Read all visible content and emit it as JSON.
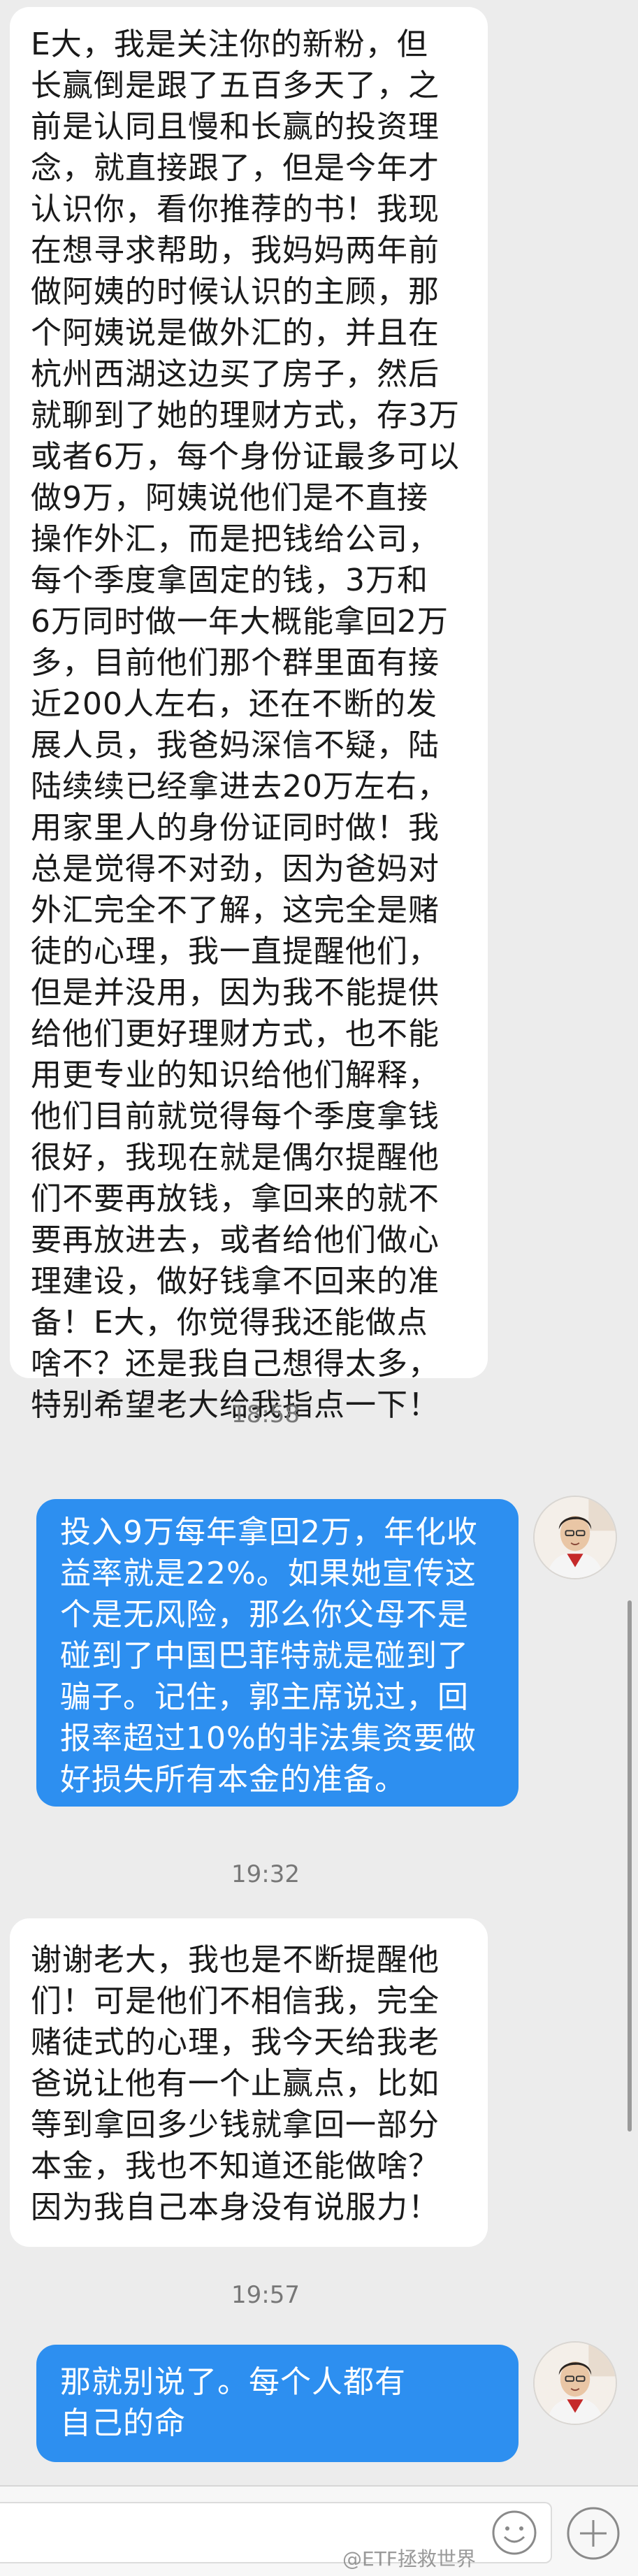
{
  "messages": [
    {
      "side": "left",
      "text": "E大，我是关注你的新粉，但\n长赢倒是跟了五百多天了，之\n前是认同且慢和长赢的投资理\n念，就直接跟了，但是今年才\n认识你，看你推荐的书！我现\n在想寻求帮助，我妈妈两年前\n做阿姨的时候认识的主顾，那\n个阿姨说是做外汇的，并且在\n杭州西湖这边买了房子，然后\n就聊到了她的理财方式，存3万\n或者6万，每个身份证最多可以\n做9万，阿姨说他们是不直接\n操作外汇，而是把钱给公司，\n每个季度拿固定的钱，3万和\n6万同时做一年大概能拿回2万\n多，目前他们那个群里面有接\n近200人左右，还在不断的发\n展人员，我爸妈深信不疑，陆\n陆续续已经拿进去20万左右，\n用家里人的身份证同时做！我\n总是觉得不对劲，因为爸妈对\n外汇完全不了解，这完全是赌\n徒的心理，我一直提醒他们，\n但是并没用，因为我不能提供\n给他们更好理财方式，也不能\n用更专业的知识给他们解释，\n他们目前就觉得每个季度拿钱\n很好，我现在就是偶尔提醒他\n们不要再放钱，拿回来的就不\n要再放进去，或者给他们做心\n理建设，做好钱拿不回来的准\n备！E大，你觉得我还能做点\n啥不？还是我自己想得太多，\n特别希望老大给我指点一下！"
    },
    {
      "side": "right",
      "text": "投入9万每年拿回2万，年化收\n益率就是22%。如果她宣传这\n个是无风险，那么你父母不是\n碰到了中国巴菲特就是碰到了\n骗子。记住，郭主席说过，回\n报率超过10%的非法集资要做\n好损失所有本金的准备。"
    },
    {
      "side": "left",
      "text": "谢谢老大，我也是不断提醒他\n们！可是他们不相信我，完全\n赌徒式的心理，我今天给我老\n爸说让他有一个止赢点，比如\n等到拿回多少钱就拿回一部分\n本金，我也不知道还能做啥？\n因为我自己本身没有说服力！"
    },
    {
      "side": "right",
      "text": "那就别说了。每个人都有\n自己的命"
    }
  ],
  "timestamps": [
    "18:58",
    "19:32",
    "19:57"
  ],
  "watermark": "@ETF拯救世界",
  "icons": {
    "avatar": "avatar-icon",
    "emoji": "emoji-icon",
    "plus": "plus-icon"
  },
  "colors": {
    "background": "#ececec",
    "left_bubble": "#ffffff",
    "right_bubble": "#2d8ff0",
    "right_text": "#ffffff"
  }
}
